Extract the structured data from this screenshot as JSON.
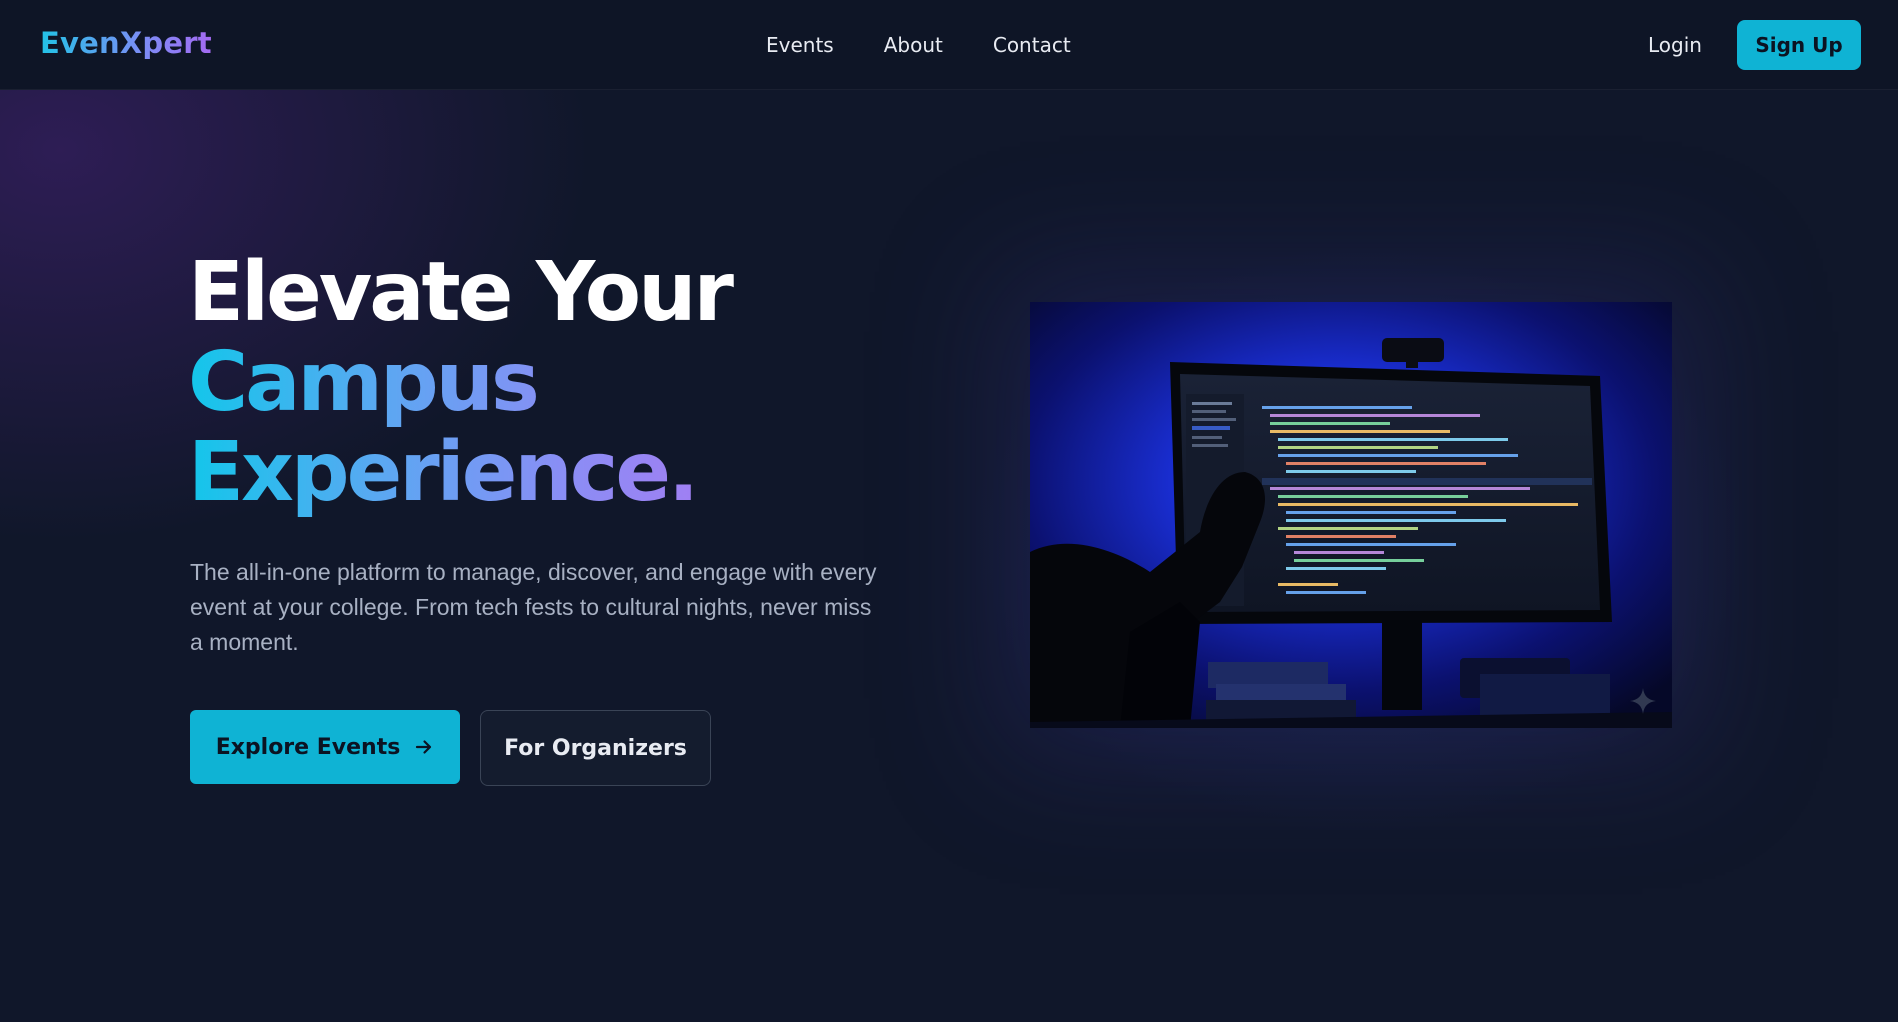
{
  "brand": {
    "logo": "EvenXpert"
  },
  "nav": {
    "links": [
      "Events",
      "About",
      "Contact"
    ],
    "login": "Login",
    "signup": "Sign Up"
  },
  "hero": {
    "title_line1": "Elevate Your",
    "title_line2": "Campus",
    "title_line3": "Experience.",
    "description": "The all-in-one platform to manage, discover, and engage with every event at your college. From tech fests to cultural nights, never miss a moment.",
    "primary_cta": "Explore Events",
    "secondary_cta": "For Organizers",
    "image_subject": "Dark desk setup with a monitor showing a code editor, lit by blue backlight"
  },
  "icons": {
    "cta_arrow": "arrow-right-icon",
    "decoration": "sparkle-icon"
  },
  "colors": {
    "background": "#10172a",
    "navbar": "#0e1526",
    "accent": "#0fb3d4",
    "gradient_start": "#13c6ea",
    "gradient_end": "#a57cf2",
    "muted_text": "#a8b1c3"
  }
}
